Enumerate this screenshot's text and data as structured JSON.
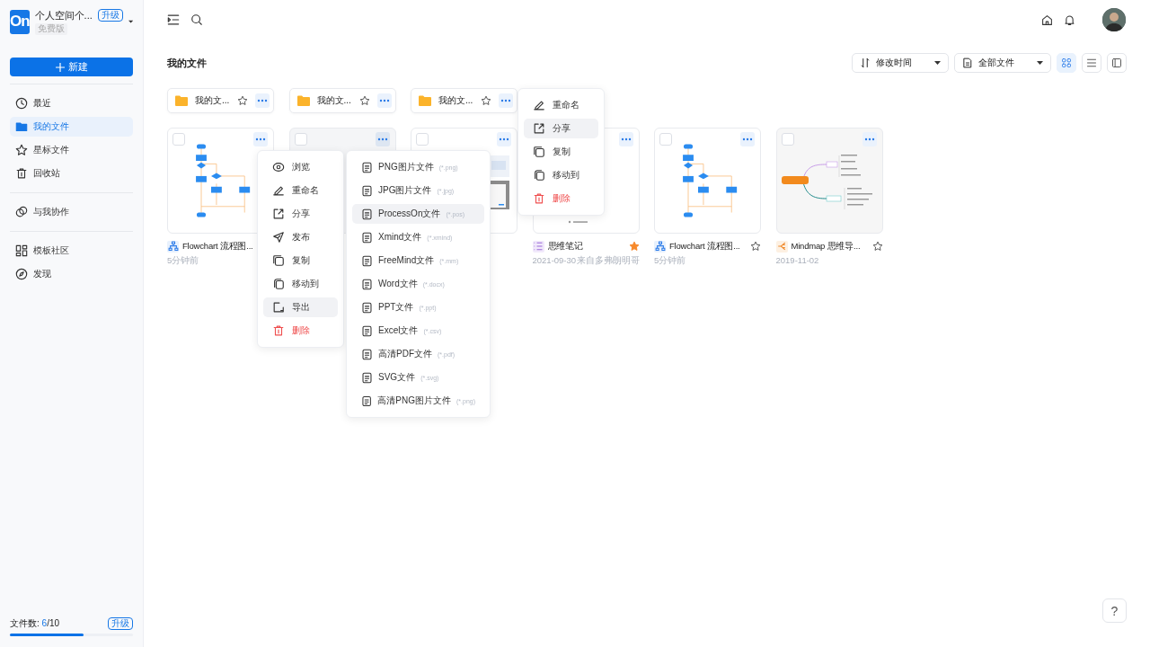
{
  "workspace": {
    "logo": "On",
    "name": "个人空间个...",
    "badge": "升级",
    "plan": "免费版"
  },
  "new_button": {
    "label": "新建"
  },
  "sidebar": {
    "groups": [
      {
        "items": [
          {
            "kind": "recent",
            "label": "最近",
            "selected": false
          },
          {
            "kind": "files",
            "label": "我的文件",
            "selected": true
          },
          {
            "kind": "starred",
            "label": "星标文件",
            "selected": false
          },
          {
            "kind": "trash",
            "label": "回收站",
            "selected": false
          }
        ]
      },
      {
        "items": [
          {
            "kind": "shared",
            "label": "与我协作",
            "selected": false
          }
        ]
      },
      {
        "items": [
          {
            "kind": "templates",
            "label": "模板社区",
            "selected": false
          },
          {
            "kind": "discover",
            "label": "发现",
            "selected": false
          }
        ]
      }
    ]
  },
  "quota": {
    "label": "文件数: ",
    "used": "6",
    "limit": "/10",
    "badge": "升级",
    "level": 0.6
  },
  "page_title": "我的文件",
  "sort": {
    "label": "修改时间"
  },
  "filter": {
    "label": "全部文件"
  },
  "views": [
    {
      "kind": "grid",
      "selected": true
    },
    {
      "kind": "list",
      "selected": false
    },
    {
      "kind": "panel",
      "selected": false
    }
  ],
  "folders": [
    {
      "name": "我的文...",
      "starred": false
    },
    {
      "name": "我的文...",
      "starred": false
    },
    {
      "name": "我的文...",
      "starred": false
    }
  ],
  "files": [
    {
      "kind": "flowchart",
      "hovered": false,
      "name": "Flowchart 流程图...",
      "date": "5分钟前"
    },
    {
      "kind": "hidden",
      "hovered": true
    },
    {
      "kind": "screenshot",
      "hovered": false
    },
    {
      "kind": "note",
      "hovered": false,
      "name": "思维笔记",
      "starred": true,
      "date": "2021-09-30",
      "source": "来自多弗朗明哥"
    },
    {
      "kind": "flowchart",
      "hovered": false,
      "name": "Flowchart 流程图...",
      "starred": false,
      "date": "5分钟前"
    },
    {
      "kind": "mindmap",
      "hovered": false,
      "name": "Mindmap 思维导...",
      "starred": false,
      "date": "2019-11-02"
    }
  ],
  "context_menu": {
    "items": [
      {
        "kind": "view",
        "label": "浏览",
        "selected": false
      },
      {
        "kind": "rename",
        "label": "重命名",
        "selected": false
      },
      {
        "kind": "share",
        "label": "分享",
        "selected": false
      },
      {
        "kind": "publish",
        "label": "发布",
        "selected": false
      },
      {
        "kind": "copy",
        "label": "复制",
        "selected": false
      },
      {
        "kind": "move",
        "label": "移动到",
        "selected": false
      },
      {
        "kind": "export",
        "label": "导出",
        "selected": true
      },
      {
        "kind": "delete",
        "label": "删除",
        "selected": false
      }
    ]
  },
  "export_menu": {
    "items": [
      {
        "label": "PNG图片文件",
        "extension": "(*.png)",
        "selected": false
      },
      {
        "label": "JPG图片文件",
        "extension": "(*.jpg)",
        "selected": false
      },
      {
        "label": "ProcessOn文件",
        "extension": "(*.pos)",
        "selected": true
      },
      {
        "label": "Xmind文件",
        "extension": "(*.xmind)",
        "selected": false
      },
      {
        "label": "FreeMind文件",
        "extension": "(*.mm)",
        "selected": false
      },
      {
        "label": "Word文件",
        "extension": "(*.docx)",
        "selected": false
      },
      {
        "label": "PPT文件",
        "extension": "(*.ppt)",
        "selected": false
      },
      {
        "label": "Excel文件",
        "extension": "(*.csv)",
        "selected": false
      },
      {
        "label": "高清PDF文件",
        "extension": "(*.pdf)",
        "selected": false
      },
      {
        "label": "SVG文件",
        "extension": "(*.svg)",
        "selected": false
      },
      {
        "label": "高清PNG图片文件",
        "extension": "(*.png)",
        "selected": false
      }
    ]
  },
  "folder_menu": {
    "items": [
      {
        "kind": "rename",
        "label": "重命名",
        "selected": false
      },
      {
        "kind": "share",
        "label": "分享",
        "selected": true
      },
      {
        "kind": "copy",
        "label": "复制",
        "selected": false
      },
      {
        "kind": "move",
        "label": "移动到",
        "selected": false
      },
      {
        "kind": "delete",
        "label": "删除",
        "selected": false
      }
    ]
  },
  "help_button": {
    "label": "?"
  }
}
